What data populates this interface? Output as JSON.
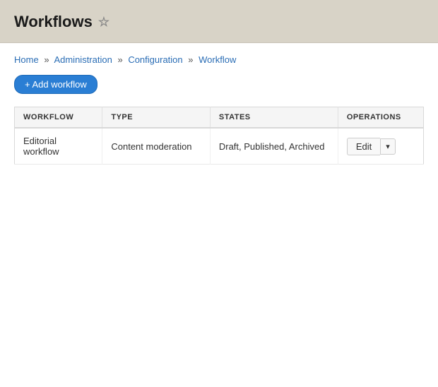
{
  "page": {
    "title": "Workflows",
    "star_label": "☆"
  },
  "breadcrumb": {
    "home": "Home",
    "administration": "Administration",
    "configuration": "Configuration",
    "workflow": "Workflow",
    "separator": "»"
  },
  "add_button": {
    "label": "+ Add workflow"
  },
  "table": {
    "columns": {
      "workflow": "WORKFLOW",
      "type": "TYPE",
      "states": "STATES",
      "operations": "OPERATIONS"
    },
    "rows": [
      {
        "workflow": "Editorial workflow",
        "type": "Content moderation",
        "states": "Draft, Published, Archived",
        "edit_label": "Edit"
      }
    ]
  }
}
